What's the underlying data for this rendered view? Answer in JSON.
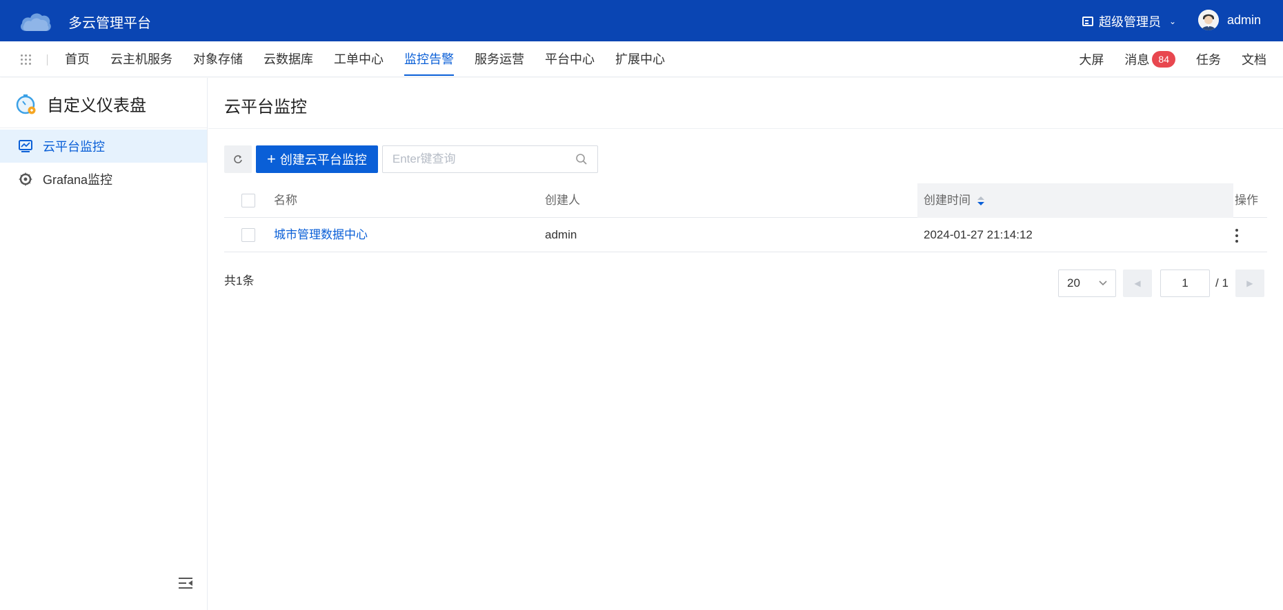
{
  "header": {
    "app_title": "多云管理平台",
    "role": "超级管理员",
    "username": "admin"
  },
  "nav": {
    "items": [
      {
        "label": "首页"
      },
      {
        "label": "云主机服务"
      },
      {
        "label": "对象存储"
      },
      {
        "label": "云数据库"
      },
      {
        "label": "工单中心"
      },
      {
        "label": "监控告警",
        "active": true
      },
      {
        "label": "服务运营"
      },
      {
        "label": "平台中心"
      },
      {
        "label": "扩展中心"
      }
    ],
    "right": {
      "screen": "大屏",
      "messages": "消息",
      "message_count": "84",
      "tasks": "任务",
      "docs": "文档"
    }
  },
  "sidebar": {
    "title": "自定义仪表盘",
    "items": [
      {
        "label": "云平台监控",
        "icon": "monitor-chart-icon",
        "active": true
      },
      {
        "label": "Grafana监控",
        "icon": "grafana-icon"
      }
    ]
  },
  "main": {
    "title": "云平台监控",
    "create_label": "创建云平台监控",
    "search_placeholder": "Enter键查询",
    "table": {
      "columns": [
        "名称",
        "创建人",
        "创建时间",
        "操作"
      ],
      "rows": [
        {
          "name": "城市管理数据中心",
          "creator": "admin",
          "created_at": "2024-01-27 21:14:12"
        }
      ]
    },
    "pagination": {
      "total": "共1条",
      "page_size": "20",
      "current_page": "1",
      "total_pages": "/ 1"
    }
  },
  "colors": {
    "header_bg": "#0a45b3",
    "accent": "#0a5fd7",
    "badge": "#e8474f"
  }
}
